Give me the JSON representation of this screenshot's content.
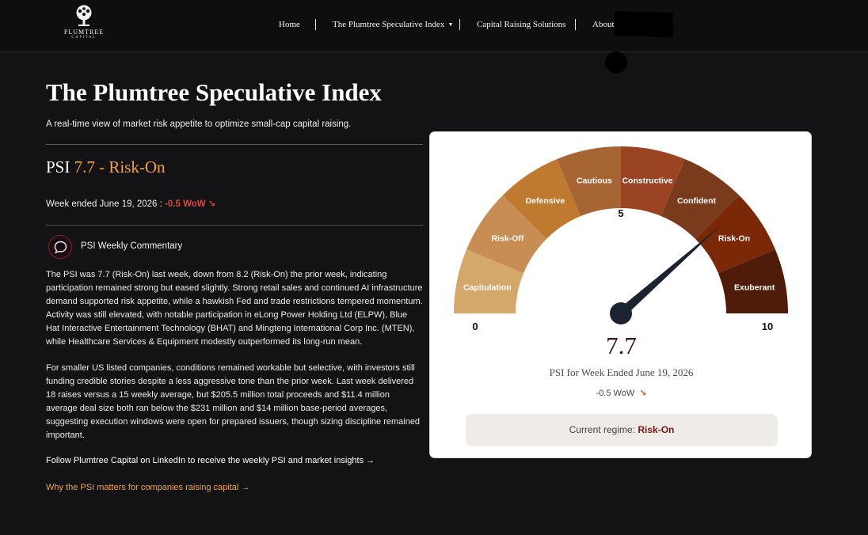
{
  "brand": {
    "name": "PLUMTREE",
    "sub": "CAPITAL",
    "logo_icon": "tree-icon"
  },
  "nav": {
    "items": [
      {
        "label": "Home"
      },
      {
        "label": "The Plumtree Speculative Index"
      },
      {
        "label": "Capital Raising Solutions"
      },
      {
        "label": "About"
      }
    ],
    "dropdown_icon": "chevron-down-icon"
  },
  "page": {
    "title": "The Plumtree Speculative Index",
    "subtitle": "A real-time view of market risk appetite to optimize small-cap capital raising."
  },
  "psi": {
    "prefix": "PSI",
    "value_regime": "7.7 - Risk-On",
    "week_label": "Week ended June 19, 2026 :",
    "change": "-0.5 WoW ↘"
  },
  "commentary": {
    "icon": "chat-bubble-icon",
    "label": "PSI Weekly Commentary",
    "paragraphs": [
      "The PSI was 7.7 (Risk-On) last week, down from 8.2 (Risk-On) the prior week, indicating participation remained strong but eased slightly. Strong retail sales and continued AI infrastructure demand supported risk appetite, while a hawkish Fed and trade restrictions tempered momentum. Activity was still elevated, with notable participation in eLong Power Holding Ltd (ELPW), Blue Hat Interactive Entertainment Technology (BHAT) and Mingteng International Corp Inc. (MTEN), while Healthcare Services & Equipment modestly outperformed its long-run mean.",
      "For smaller US listed companies, conditions remained workable but selective, with investors still funding credible stories despite a less aggressive tone than the prior week. Last week delivered 18 raises versus a 15 weekly average, but $205.5 million total proceeds and $11.4 million average deal size both ran below the $231 million and $14 million base-period averages, suggesting execution windows were open for prepared issuers, though sizing discipline remained important."
    ],
    "linkedin_link": "Follow Plumtree Capital on LinkedIn to receive the weekly PSI and market insights →",
    "why_link": "Why the PSI matters for companies raising capital →"
  },
  "gauge": {
    "min_label": "0",
    "mid_label": "5",
    "max_label": "10",
    "score": "7.7",
    "caption": "PSI for Week Ended June 19, 2026",
    "wow_text": "-0.5 WoW",
    "wow_arrow": "↘",
    "regime_label": "Current regime:",
    "regime_value": "Risk-On",
    "needle_value": 7.7,
    "scale_max": 10,
    "segments": [
      {
        "label": "Capitulation",
        "color": "#d4a86a"
      },
      {
        "label": "Risk-Off",
        "color": "#c88d53"
      },
      {
        "label": "Defensive",
        "color": "#c07a30"
      },
      {
        "label": "Cautious",
        "color": "#a86534"
      },
      {
        "label": "Constructive",
        "color": "#9b4423"
      },
      {
        "label": "Confident",
        "color": "#7a3a1c"
      },
      {
        "label": "Risk-On",
        "color": "#7a2806"
      },
      {
        "label": "Exuberant",
        "color": "#4e1c08"
      }
    ],
    "needle_color": "#1c2330"
  }
}
